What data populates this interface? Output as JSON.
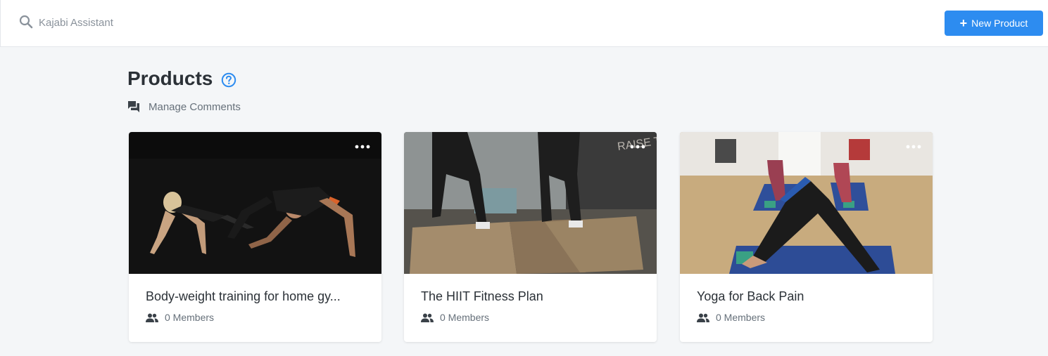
{
  "topbar": {
    "search_placeholder": "Kajabi Assistant",
    "new_product_label": "New Product"
  },
  "page": {
    "title": "Products",
    "manage_comments_label": "Manage Comments"
  },
  "products": [
    {
      "title": "Body-weight training for home gy...",
      "members": "0 Members"
    },
    {
      "title": "The HIIT Fitness Plan",
      "members": "0 Members"
    },
    {
      "title": "Yoga for Back Pain",
      "members": "0 Members"
    }
  ],
  "image_texts": {
    "gym_wall_sign": "RAISE THE BAR"
  },
  "colors": {
    "accent": "#2d8cf0",
    "background": "#f4f6f8",
    "text": "#2b3137",
    "muted": "#66707a"
  },
  "icons": [
    "search-icon",
    "plus-icon",
    "help-circle-icon",
    "comments-icon",
    "more-dots-icon",
    "members-icon"
  ]
}
